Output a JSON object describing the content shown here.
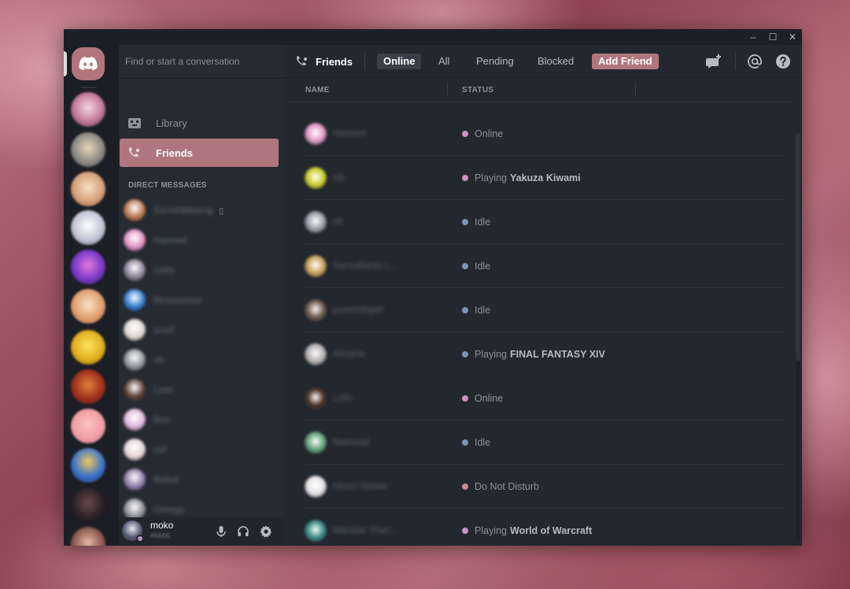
{
  "window": {
    "controls": {
      "minimize": "–",
      "maximize": "☐",
      "close": "✕"
    }
  },
  "search": {
    "placeholder": "Find or start a conversation"
  },
  "nav": {
    "library": "Library",
    "friends": "Friends"
  },
  "direct_messages": {
    "heading": "DIRECT MESSAGES",
    "items": [
      {
        "name": "S1rVinMelong",
        "color": "#b8744c",
        "phone": true
      },
      {
        "name": "Hamnet",
        "color": "#e08ec0"
      },
      {
        "name": "cellis",
        "color": "#8a7f94"
      },
      {
        "name": "Blossomize",
        "color": "#2d7ad0"
      },
      {
        "name": "snarf",
        "color": "#ddd6cc"
      },
      {
        "name": "oh",
        "color": "#8d9196"
      },
      {
        "name": "Lelin",
        "color": "#5a3d30"
      },
      {
        "name": "Bon",
        "color": "#e2b6dc"
      },
      {
        "name": "oof",
        "color": "#e4d4d6"
      },
      {
        "name": "Bobut",
        "color": "#8f7aa6"
      },
      {
        "name": "Omega",
        "color": "#8a8c92"
      }
    ]
  },
  "user": {
    "name": "moko",
    "tag": "#6666"
  },
  "topbar": {
    "title": "Friends",
    "tabs": {
      "online": "Online",
      "all": "All",
      "pending": "Pending",
      "blocked": "Blocked",
      "add_friend": "Add Friend"
    }
  },
  "columns": {
    "name": "NAME",
    "status": "STATUS"
  },
  "colors": {
    "accent": "#b0767d",
    "online": "#c694c6",
    "idle": "#7f93b8",
    "dnd": "#c98a90"
  },
  "friends": [
    {
      "name": "Hamnet",
      "status": "Online",
      "kind": "online",
      "game": "",
      "color": "#e39ac8"
    },
    {
      "name": "sib",
      "status": "Playing",
      "kind": "online",
      "game": "Yakuza Kiwami",
      "color": "#c9d02a"
    },
    {
      "name": "oh",
      "status": "Idle",
      "kind": "idle",
      "game": "",
      "color": "#9aa0a6"
    },
    {
      "name": "Samuiliante L...",
      "status": "Idle",
      "kind": "idle",
      "game": "",
      "color": "#c9a35c"
    },
    {
      "name": "juveninbgde",
      "status": "Idle",
      "kind": "idle",
      "game": "",
      "color": "#6e5a4c"
    },
    {
      "name": "Alinaria",
      "status": "Playing",
      "kind": "idle",
      "game": "FINAL FANTASY XIV",
      "color": "#b7b2b4"
    },
    {
      "name": "Lelin",
      "status": "Online",
      "kind": "online",
      "game": "",
      "color": "#4a3024"
    },
    {
      "name": "Mamead",
      "status": "Idle",
      "kind": "idle",
      "game": "",
      "color": "#67a57c"
    },
    {
      "name": "Houni Natale",
      "status": "Do Not Disturb",
      "kind": "dnd",
      "game": "",
      "color": "#e6e4e6"
    },
    {
      "name": "Mardian Then...",
      "status": "Playing",
      "kind": "online",
      "game": "World of Warcraft",
      "color": "#3a8a86"
    }
  ]
}
